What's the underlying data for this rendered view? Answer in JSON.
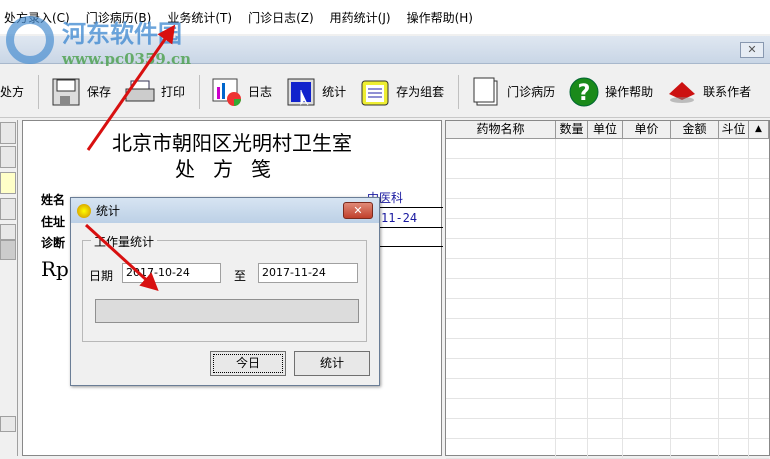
{
  "menu": [
    "处方录入(C)",
    "门诊病历(B)",
    "业务统计(T)",
    "门诊日志(Z)",
    "用药统计(J)",
    "操作帮助(H)"
  ],
  "watermark": {
    "name": "河东软件园",
    "url": "www.pc0359.cn"
  },
  "caption_close": "✕",
  "toolbar": [
    {
      "label": "处方",
      "icon": "prescription-icon"
    },
    {
      "label": "保存",
      "icon": "floppy-icon"
    },
    {
      "label": "打印",
      "icon": "printer-icon"
    },
    {
      "label": "日志",
      "icon": "log-chart-icon"
    },
    {
      "label": "统计",
      "icon": "statistics-icon"
    },
    {
      "label": "存为组套",
      "icon": "clipboard-icon"
    },
    {
      "label": "门诊病历",
      "icon": "document-icon"
    },
    {
      "label": "操作帮助",
      "icon": "help-icon"
    },
    {
      "label": "联系作者",
      "icon": "contact-icon"
    }
  ],
  "document": {
    "hospital": "北京市朝阳区光明村卫生室",
    "title": "处方笺",
    "name_label": "姓名",
    "address_label": "住址",
    "diagnosis_label": "诊断",
    "rp": "Rp",
    "department": "中医科",
    "date_partial": "11-24"
  },
  "grid": {
    "columns": [
      "药物名称",
      "数量",
      "单位",
      "单价",
      "金额",
      "斗位"
    ]
  },
  "dialog": {
    "title": "统计",
    "close": "✕",
    "group": "工作量统计",
    "date_label": "日期",
    "from": "2017-10-24",
    "to_label": "至",
    "to": "2017-11-24",
    "progress": 0,
    "today_button": "今日",
    "stat_button": "统计"
  }
}
